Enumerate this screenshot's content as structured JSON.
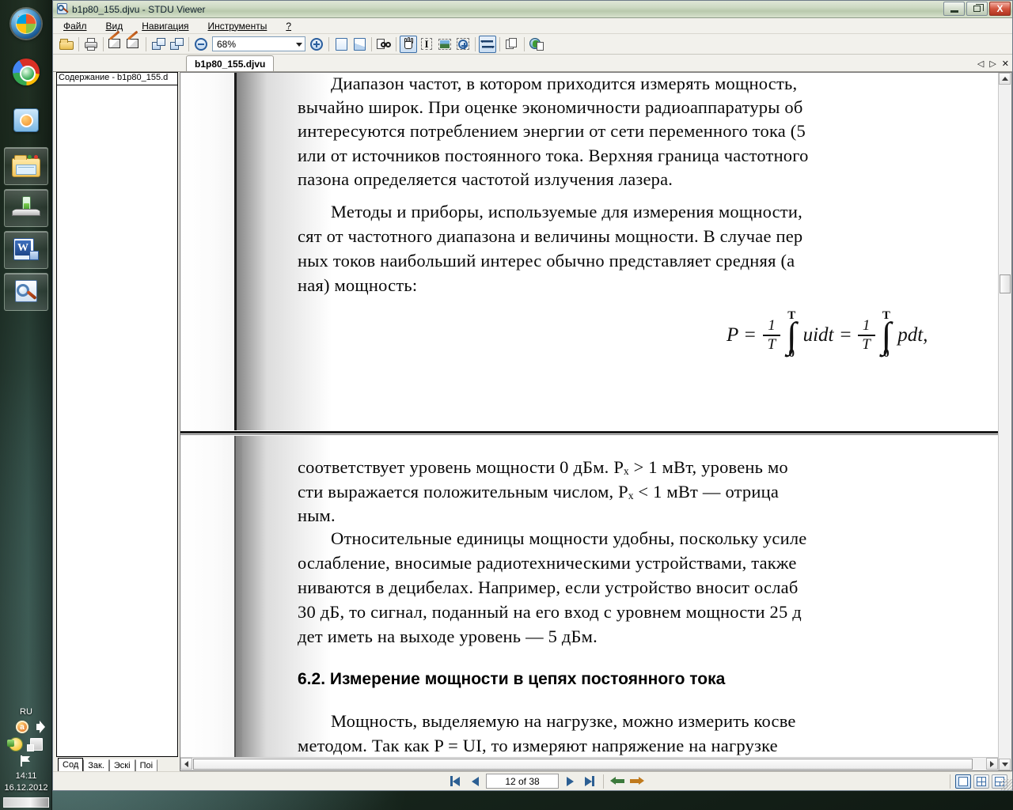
{
  "window": {
    "title": "b1p80_155.djvu - STDU Viewer",
    "app_icon": "stdu-viewer-icon",
    "minimize_label": "Свернуть",
    "restore_label": "Восстановить",
    "close_label": "X"
  },
  "menu": [
    {
      "label": "Файл",
      "accel": "Ф"
    },
    {
      "label": "Вид",
      "accel": "В"
    },
    {
      "label": "Навигация",
      "accel": "Н"
    },
    {
      "label": "Инструменты",
      "accel": "И"
    },
    {
      "label": "?",
      "accel": ""
    }
  ],
  "toolbar": {
    "open_label": "Открыть",
    "print_label": "Печать",
    "rotate_left_label": "Повернуть влево",
    "rotate_right_label": "Повернуть вправо",
    "prev_view_label": "Предыдущий вид",
    "next_view_label": "Следующий вид",
    "zoom_out_label": "Уменьшить",
    "zoom_value": "68%",
    "zoom_in_label": "Увеличить",
    "fit_page_label": "По странице",
    "fit_width_label": "По ширине",
    "find_label": "Поиск",
    "hand_tool_label": "Рука",
    "text_select_label": "Выделение текста",
    "image_select_label": "Выделение изображения",
    "zoom_select_label": "Выделение масштаба",
    "two_page_label": "Две страницы",
    "copy_label": "Копировать",
    "browser_label": "Открыть в браузере"
  },
  "tabs": {
    "documents": [
      {
        "label": "b1p80_155.djvu",
        "active": true
      }
    ],
    "prev_label": "◁",
    "next_label": "▷",
    "close_label": "✕"
  },
  "sidebar": {
    "header": "Содержание - b1p80_155.d",
    "tabs": [
      {
        "label": "Сод",
        "active": true
      },
      {
        "label": "Зак.",
        "active": false
      },
      {
        "label": "Эскі",
        "active": false
      },
      {
        "label": "Поі",
        "active": false
      }
    ]
  },
  "document": {
    "page_top": {
      "paragraphs": [
        [
          "Диапазон частот, в котором приходится измерять мощность,",
          "вычайно широк. При оценке экономичности радиоаппаратуры об",
          "интересуются потреблением энергии от сети переменного тока (5",
          "или от источников постоянного тока. Верхняя граница частотного",
          "пазона определяется частотой излучения лазера."
        ],
        [
          "Методы и приборы, используемые для измерения мощности,",
          "сят от частотного диапазона и величины мощности. В случае пер",
          "ных токов наибольший интерес обычно представляет средняя (а",
          "ная) мощность:"
        ]
      ],
      "formula": {
        "lhs": "P =",
        "frac_num": "1",
        "frac_den": "T",
        "integral_upper": "T",
        "integral_lower": "0",
        "integral_sign": "∫",
        "integrand1": "uidt",
        "eq2": "=",
        "integrand2": "pdt,"
      }
    },
    "page_bottom": {
      "paragraphs": [
        [
          "соответствует уровень мощности 0 дБм. Pₓ > 1 мВт, уровень мо",
          "сти выражается положительным числом, Pₓ < 1 мВт — отрица",
          "ным."
        ],
        [
          "Относительные единицы мощности удобны, поскольку усиле",
          "ослабление, вносимые радиотехническими устройствами, также",
          "ниваются в децибелах. Например, если устройство вносит ослаб",
          "30 дБ, то сигнал, поданный на его вход с уровнем мощности 25 д",
          "дет иметь на выходе уровень — 5 дБм."
        ]
      ],
      "heading": "6.2. Измерение мощности в цепях постоянного тока",
      "paragraphs2": [
        [
          "Мощность, выделяемую на нагрузке, можно измерить косве",
          "методом. Так как P = UI, то измеряют напряжение на нагрузке"
        ]
      ]
    }
  },
  "statusbar": {
    "first_page_label": "Первая страница",
    "prev_page_label": "Предыдущая страница",
    "page_indicator": "12 of 38",
    "next_page_label": "Следующая страница",
    "last_page_label": "Последняя страница",
    "back_label": "Назад",
    "forward_label": "Вперёд",
    "view_single_label": "Одна страница",
    "view_split_label": "Разделить",
    "view_split3_label": "Разделить на три"
  },
  "taskbar": {
    "start_label": "Пуск",
    "items": [
      {
        "icon": "start-orb-icon",
        "label": "Пуск"
      },
      {
        "icon": "maxthon-browser-icon",
        "label": "Maxthon"
      },
      {
        "icon": "media-player-icon",
        "label": "Медиаплеер"
      },
      {
        "icon": "explorer-folder-icon",
        "label": "Проводник"
      },
      {
        "icon": "app-green-icon",
        "label": "Программа"
      },
      {
        "icon": "word-icon",
        "label": "Microsoft Word",
        "glyph": "W"
      },
      {
        "icon": "stdu-viewer-icon",
        "label": "STDU Viewer"
      }
    ]
  },
  "tray": {
    "language": "RU",
    "icons": [
      {
        "icon": "antivirus-icon"
      },
      {
        "icon": "volume-icon"
      },
      {
        "icon": "messenger-icon"
      },
      {
        "icon": "network-icon"
      },
      {
        "icon": "flag-icon"
      }
    ],
    "time": "14:11",
    "date": "16.12.2012"
  }
}
